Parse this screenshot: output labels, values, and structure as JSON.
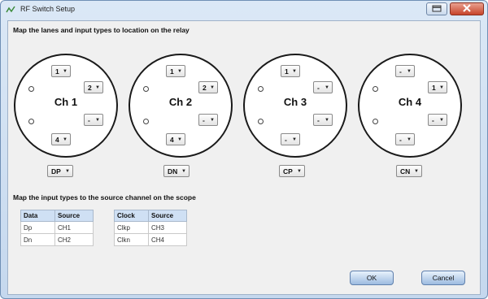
{
  "window": {
    "title": "RF Switch Setup"
  },
  "relay_section": {
    "label": "Map the lanes and input types to location on the relay"
  },
  "connectors": [
    {
      "label": "Ch 1",
      "pos_top": "1",
      "pos_right_upper": "2",
      "pos_right_lower": "-",
      "pos_bottom": "4",
      "input_type": "DP"
    },
    {
      "label": "Ch 2",
      "pos_top": "1",
      "pos_right_upper": "2",
      "pos_right_lower": "-",
      "pos_bottom": "4",
      "input_type": "DN"
    },
    {
      "label": "Ch 3",
      "pos_top": "1",
      "pos_right_upper": "-",
      "pos_right_lower": "-",
      "pos_bottom": "-",
      "input_type": "CP"
    },
    {
      "label": "Ch 4",
      "pos_top": "-",
      "pos_right_upper": "1",
      "pos_right_lower": "-",
      "pos_bottom": "-",
      "input_type": "CN"
    }
  ],
  "scope_section": {
    "label": "Map the input types to the source channel on the scope"
  },
  "data_table": {
    "headers": [
      "Data",
      "Source"
    ],
    "rows": [
      [
        "Dp",
        "CH1"
      ],
      [
        "Dn",
        "CH2"
      ]
    ]
  },
  "clock_table": {
    "headers": [
      "Clock",
      "Source"
    ],
    "rows": [
      [
        "Clkp",
        "CH3"
      ],
      [
        "Clkn",
        "CH4"
      ]
    ]
  },
  "buttons": {
    "ok": "OK",
    "cancel": "Cancel"
  },
  "colors": {
    "title_bar": "#c5d8ee",
    "close_button": "#c7442a",
    "table_header": "#cfe0f4",
    "button": "#9dbbe0"
  },
  "icons": {
    "app": "rf-switch-icon",
    "restore": "restore-icon",
    "close": "close-icon"
  }
}
